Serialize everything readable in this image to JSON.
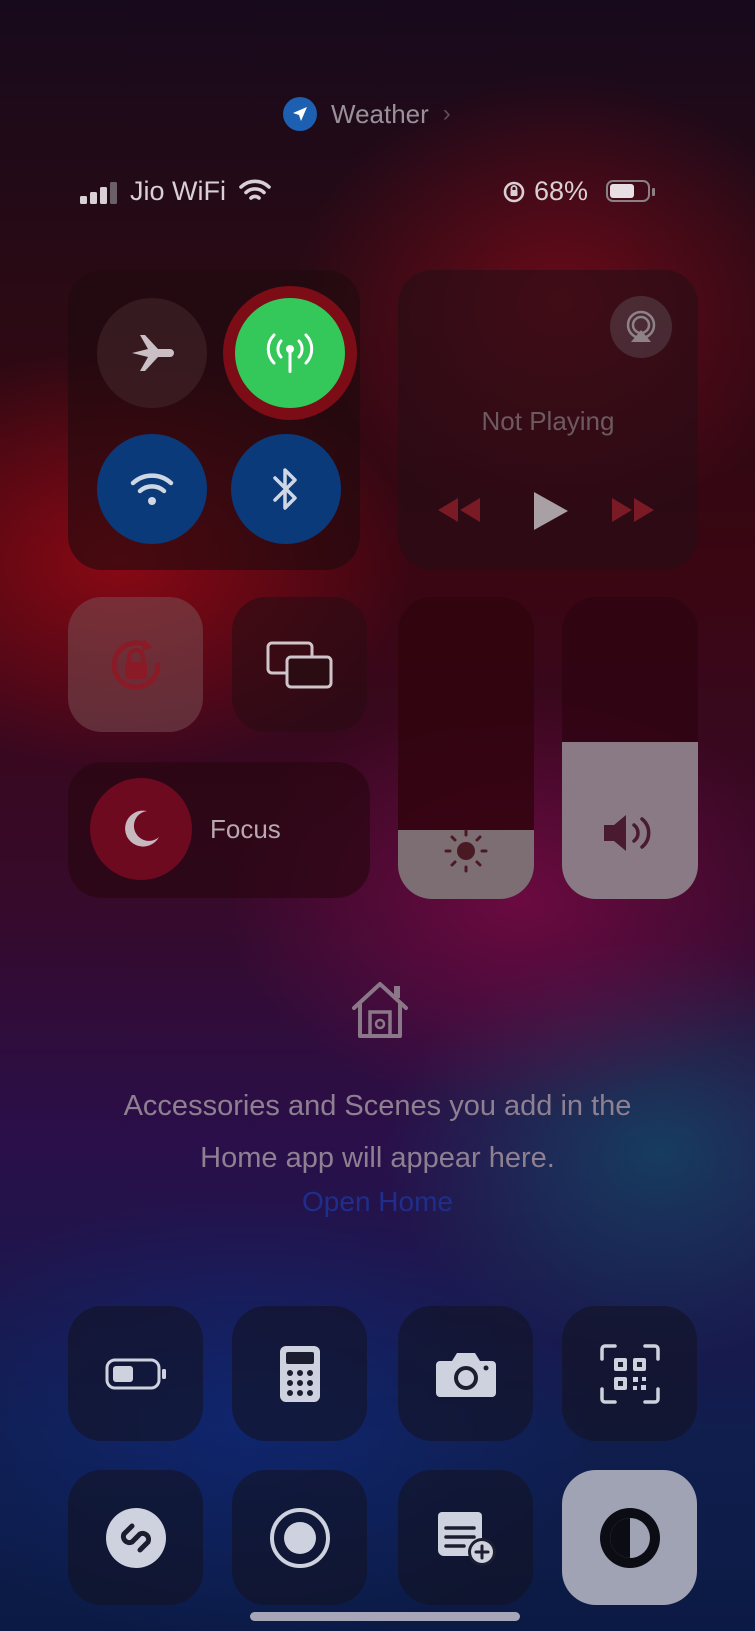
{
  "header": {
    "location_label": "Weather"
  },
  "status_bar": {
    "carrier": "Jio WiFi",
    "battery_percent": "68%",
    "battery_level": 0.68
  },
  "connectivity": {
    "airplane_mode": false,
    "cellular_data": true,
    "wifi": true,
    "bluetooth": true
  },
  "now_playing": {
    "status": "Not Playing"
  },
  "focus": {
    "label": "Focus"
  },
  "brightness_level": 0.23,
  "volume_level": 0.52,
  "home": {
    "message": "Accessories and Scenes you add in the Home app will appear here.",
    "open_link": "Open Home"
  },
  "colors": {
    "cellular_active": "#34c759",
    "toggle_blue": "#0a3a7a",
    "media_accent": "#7a1a24"
  },
  "icons": [
    "location-arrow-icon",
    "signal-icon",
    "wifi-icon",
    "orientation-lock-icon",
    "battery-icon",
    "airplane-icon",
    "antenna-icon",
    "bluetooth-icon",
    "airplay-icon",
    "rewind-icon",
    "play-icon",
    "fast-forward-icon",
    "screen-mirroring-icon",
    "moon-icon",
    "sun-icon",
    "speaker-icon",
    "home-icon",
    "low-power-icon",
    "calculator-icon",
    "camera-icon",
    "qr-code-icon",
    "shazam-icon",
    "screen-record-icon",
    "quick-note-icon",
    "dark-mode-icon"
  ]
}
